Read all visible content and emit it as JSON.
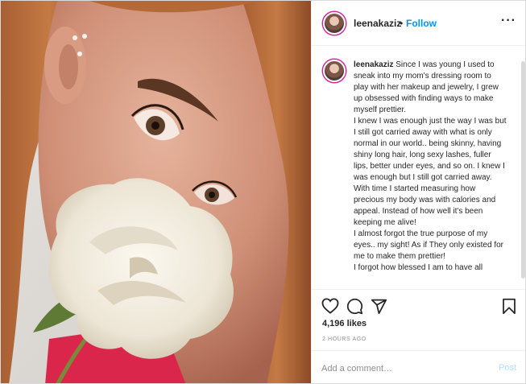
{
  "header": {
    "username": "leenakaziz",
    "separator": "•",
    "follow_label": "Follow",
    "more_label": "···"
  },
  "caption": {
    "username": "leenakaziz",
    "text": "Since I was young I used to sneak into my mom's dressing room to play with her makeup and jewelry, I grew up obsessed with finding ways to make myself prettier.\nI knew I was enough just the way I was but I still got carried away with what is only normal in our world.. being skinny, having shiny long hair, long sexy lashes, fuller lips, better under eyes, and so on. I knew I was enough but I still got carried away.\nWith time I started measuring how precious my body was with calories and appeal. Instead of how well it's been keeping me alive!\nI almost forgot the true purpose of my eyes.. my sight! As if They only existed for me to make them prettier!\nI forgot how blessed I am to have all"
  },
  "stats": {
    "likes": "4,196 likes",
    "time": "2 HOURS AGO"
  },
  "comment": {
    "placeholder": "Add a comment…",
    "post_label": "Post"
  },
  "icons": {
    "like": "heart-icon",
    "comment": "comment-icon",
    "share": "send-icon",
    "save": "bookmark-icon"
  },
  "colors": {
    "follow": "#0095f6",
    "post_disabled": "#b2dffc",
    "story_ring": "#d6249f"
  }
}
